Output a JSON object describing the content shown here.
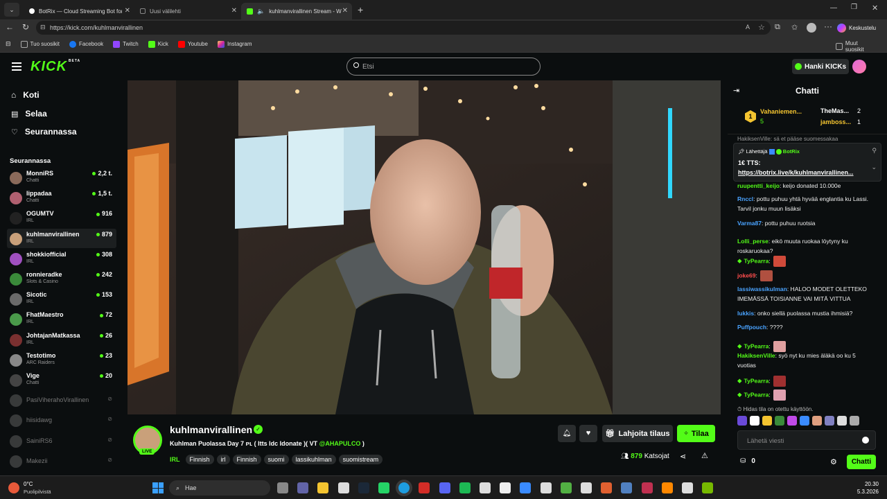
{
  "browser": {
    "tabs": [
      {
        "title": "BotRix — Cloud Streaming Bot for",
        "active": false
      },
      {
        "title": "Uusi välilehti",
        "active": false
      },
      {
        "title": "kuhlmanvirallinen Stream - W",
        "active": true
      }
    ],
    "url": "https://kick.com/kuhlmanvirallinen",
    "profile_label": "Keskustelu",
    "bookmarks": [
      "Tuo suosikit",
      "Facebook",
      "Twitch",
      "Kick",
      "Youtube",
      "Instagram"
    ],
    "other_bookmarks": "Muut suosikit"
  },
  "header": {
    "logo": "KICK",
    "logo_badge": "BETA",
    "search_placeholder": "Etsi",
    "get_kicks": "Hanki KICKs"
  },
  "sidebar": {
    "nav": [
      {
        "label": "Koti",
        "icon": "home-icon"
      },
      {
        "label": "Selaa",
        "icon": "browse-icon"
      },
      {
        "label": "Seurannassa",
        "icon": "heart-icon"
      }
    ],
    "following_title": "Seurannassa",
    "channels": [
      {
        "name": "MonniRS",
        "category": "Chatti",
        "viewers": "2,2 t.",
        "color": "#8a6a5a",
        "live": true
      },
      {
        "name": "lippadaa",
        "category": "Chatti",
        "viewers": "1,5 t.",
        "color": "#b06070",
        "live": true
      },
      {
        "name": "OGUMTV",
        "category": "IRL",
        "viewers": "916",
        "color": "#222222",
        "live": true
      },
      {
        "name": "kuhlmanvirallinen",
        "category": "IRL",
        "viewers": "879",
        "color": "#c9a07a",
        "live": true,
        "selected": true
      },
      {
        "name": "shokkiofficial",
        "category": "IRL",
        "viewers": "308",
        "color": "#a050c0",
        "live": true
      },
      {
        "name": "ronnieradke",
        "category": "Slots & Casino",
        "viewers": "242",
        "color": "#3a8a3a",
        "live": true
      },
      {
        "name": "Sicotic",
        "category": "IRL",
        "viewers": "153",
        "color": "#6a6a6a",
        "live": true
      },
      {
        "name": "FhatMaestro",
        "category": "IRL",
        "viewers": "72",
        "color": "#4a9a4a",
        "live": true
      },
      {
        "name": "JohtajanMatkassa",
        "category": "IRL",
        "viewers": "26",
        "color": "#7a3030",
        "live": true
      },
      {
        "name": "Testotimo",
        "category": "ARC Raiders",
        "viewers": "23",
        "color": "#888888",
        "live": true
      },
      {
        "name": "Vige",
        "category": "Chatti",
        "viewers": "20",
        "color": "#444444",
        "live": true
      },
      {
        "name": "PasiViherahoVirallinen",
        "category": "",
        "viewers": "",
        "color": "#666666",
        "live": false
      },
      {
        "name": "hiisidawg",
        "category": "",
        "viewers": "",
        "color": "#666666",
        "live": false
      },
      {
        "name": "SainiRS6",
        "category": "",
        "viewers": "",
        "color": "#666666",
        "live": false
      },
      {
        "name": "Makezii",
        "category": "",
        "viewers": "",
        "color": "#666666",
        "live": false
      }
    ]
  },
  "stream": {
    "channel": "kuhlmanvirallinen",
    "live_badge": "LIVE",
    "title": "Kuhlman Puolassa Day 7 ᴘʟ ( Itts Idc Idonate )( VT ",
    "title_mention": "@AHAPULCO",
    "title_end": " )",
    "tags": [
      "IRL",
      "Finnish",
      "irl",
      "Finnish",
      "suomi",
      "lassikuhlman",
      "suomistream"
    ],
    "gift_sub": "Lahjoita tilaus",
    "subscribe": "Tilaa",
    "viewers": "879",
    "viewers_label": "Katsojat"
  },
  "chat": {
    "title": "Chatti",
    "leaderboard": [
      {
        "name": "Vahaniemen...",
        "count": "5",
        "rank": "1"
      },
      {
        "name": "TheMas...",
        "count": "2"
      },
      {
        "name": "jamboss...",
        "count": "1"
      }
    ],
    "pinned": {
      "sender_label": "Lähettäjä",
      "sender": "BotRix",
      "text1": "1€ TTS:",
      "text2": "https://botrix.live/k/kuhlmanvirallinen..."
    },
    "partial_top": "HakiksenVille: sä et pääse suomessakaa",
    "messages": [
      {
        "user": "ruupentti_keijo",
        "color": "#53fc18",
        "text": ": keijo donated 10.000e"
      },
      {
        "user": "Rnccl",
        "color": "#4aa3ff",
        "text": ": pottu puhuu yhtä hyvää englantia ku Lassi. Tarvil jonku muun lisäksi"
      },
      {
        "user": "Varma87",
        "color": "#4aa3ff",
        "text": ": pottu puhuu ruotsia"
      },
      {
        "user": "Lolli_perse",
        "color": "#53fc18",
        "text": ": eikö muuta ruokaa löytyny ku roskaruokaa?"
      },
      {
        "user": "TyPearra",
        "color": "#53fc18",
        "text": ":"
      },
      {
        "user": "joke69",
        "color": "#ff4d4d",
        "text": ":"
      },
      {
        "user": "lassiwassikulman",
        "color": "#4aa3ff",
        "text": ": HALOO MODET OLETTEKO IMEMÄSSÄ TOISIANNE VAI MITÄ VITTUA"
      },
      {
        "user": "lukkis",
        "color": "#4aa3ff",
        "text": ": onko siellä puolassa mustia ihmisiä?"
      },
      {
        "user": "Puffpouch",
        "color": "#4aa3ff",
        "text": ": ????"
      },
      {
        "user": "TyPearra",
        "color": "#53fc18",
        "text": ":"
      },
      {
        "user": "HakiksenVille",
        "color": "#53fc18",
        "text": ": syö nyt ku mies äläkä oo ku 5 vuotias"
      },
      {
        "user": "TyPearra",
        "color": "#53fc18",
        "text": ":"
      },
      {
        "user": "TyPearra",
        "color": "#53fc18",
        "text": ":"
      }
    ],
    "slow_mode": "Hidas tila on otettu käyttöön.",
    "input_placeholder": "Lähetä viesti",
    "points": "0",
    "send_button": "Chatti"
  },
  "taskbar": {
    "weather_temp": "0°C",
    "weather_desc": "Puolipilvistä",
    "search": "Hae",
    "time": "20.30",
    "date": "5.3.2026"
  },
  "colors": {
    "accent": "#53fc18",
    "background": "#0b0e0f"
  }
}
